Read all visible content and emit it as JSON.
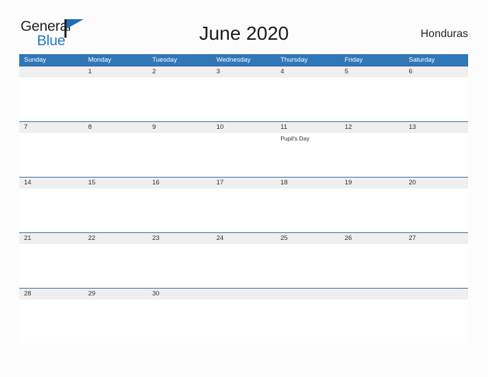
{
  "brand": {
    "name_top": "General",
    "name_bottom": "Blue",
    "triangle_icon": "blue-triangle-icon",
    "accent_color": "#1b7ac6"
  },
  "header": {
    "title": "June 2020",
    "country": "Honduras"
  },
  "theme": {
    "header_blue": "#3077b8",
    "band_gray": "#efefef",
    "separator_blue": "#2e6da4",
    "page_background": "#fcfcfc",
    "text_dark": "#2b2b2b"
  },
  "calendar": {
    "month": "June",
    "year": "2020",
    "weekdays": [
      "Sunday",
      "Monday",
      "Tuesday",
      "Wednesday",
      "Thursday",
      "Friday",
      "Saturday"
    ],
    "weeks": [
      [
        {
          "date": "",
          "event": ""
        },
        {
          "date": "1",
          "event": ""
        },
        {
          "date": "2",
          "event": ""
        },
        {
          "date": "3",
          "event": ""
        },
        {
          "date": "4",
          "event": ""
        },
        {
          "date": "5",
          "event": ""
        },
        {
          "date": "6",
          "event": ""
        }
      ],
      [
        {
          "date": "7",
          "event": ""
        },
        {
          "date": "8",
          "event": ""
        },
        {
          "date": "9",
          "event": ""
        },
        {
          "date": "10",
          "event": ""
        },
        {
          "date": "11",
          "event": "Pupil's Day"
        },
        {
          "date": "12",
          "event": ""
        },
        {
          "date": "13",
          "event": ""
        }
      ],
      [
        {
          "date": "14",
          "event": ""
        },
        {
          "date": "15",
          "event": ""
        },
        {
          "date": "16",
          "event": ""
        },
        {
          "date": "17",
          "event": ""
        },
        {
          "date": "18",
          "event": ""
        },
        {
          "date": "19",
          "event": ""
        },
        {
          "date": "20",
          "event": ""
        }
      ],
      [
        {
          "date": "21",
          "event": ""
        },
        {
          "date": "22",
          "event": ""
        },
        {
          "date": "23",
          "event": ""
        },
        {
          "date": "24",
          "event": ""
        },
        {
          "date": "25",
          "event": ""
        },
        {
          "date": "26",
          "event": ""
        },
        {
          "date": "27",
          "event": ""
        }
      ],
      [
        {
          "date": "28",
          "event": ""
        },
        {
          "date": "29",
          "event": ""
        },
        {
          "date": "30",
          "event": ""
        },
        {
          "date": "",
          "event": ""
        },
        {
          "date": "",
          "event": ""
        },
        {
          "date": "",
          "event": ""
        },
        {
          "date": "",
          "event": ""
        }
      ]
    ]
  }
}
